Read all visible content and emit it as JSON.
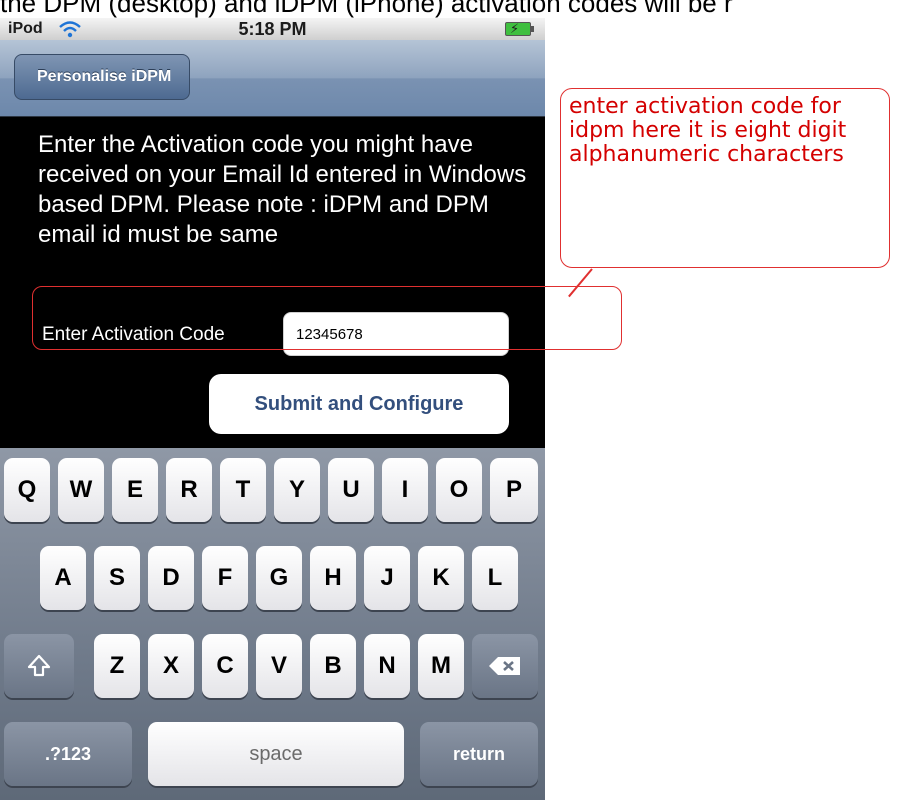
{
  "caption": "the DPM (desktop) and iDPM (iPhone) activation codes will be r",
  "status_bar": {
    "carrier": "iPod",
    "time": "5:18 PM"
  },
  "nav": {
    "back_label": "Personalise iDPM"
  },
  "instructions": "Enter the Activation code you might have received on your Email Id entered in Windows based DPM. Please note : iDPM and DPM email id must be same",
  "activation": {
    "label": "Enter Activation Code",
    "value": "12345678"
  },
  "submit_label": "Submit and Configure",
  "keyboard": {
    "row1": [
      "Q",
      "W",
      "E",
      "R",
      "T",
      "Y",
      "U",
      "I",
      "O",
      "P"
    ],
    "row2": [
      "A",
      "S",
      "D",
      "F",
      "G",
      "H",
      "J",
      "K",
      "L"
    ],
    "row3": [
      "Z",
      "X",
      "C",
      "V",
      "B",
      "N",
      "M"
    ],
    "numbers_label": ".?123",
    "space_label": "space",
    "return_label": "return",
    "shift_icon": "shift-icon",
    "delete_icon": "delete-icon"
  },
  "annotation": {
    "text": "enter activation code for idpm here it is eight digit alphanumeric characters",
    "color": "#d40000"
  }
}
